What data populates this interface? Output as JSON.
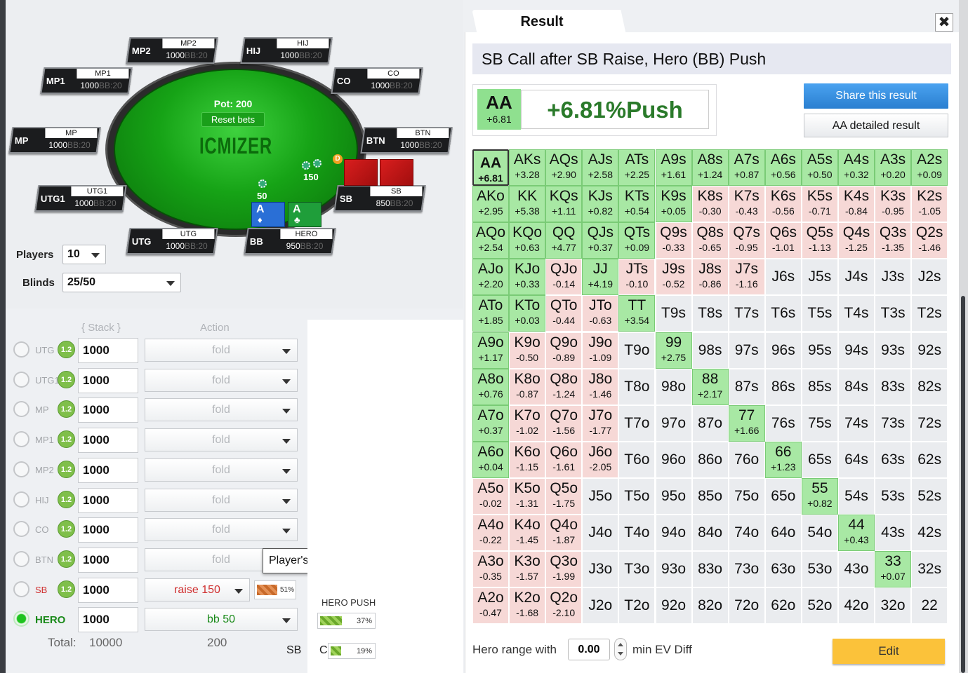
{
  "table": {
    "watermark": "ICMIZER",
    "pot_label": "Pot: 200",
    "reset_label": "Reset bets",
    "seats": [
      {
        "pos": "MP2",
        "name": "MP2",
        "stack": "1000",
        "suffix": "BB:20"
      },
      {
        "pos": "HIJ",
        "name": "HIJ",
        "stack": "1000",
        "suffix": "BB:20"
      },
      {
        "pos": "MP1",
        "name": "MP1",
        "stack": "1000",
        "suffix": "BB:20"
      },
      {
        "pos": "CO",
        "name": "CO",
        "stack": "1000",
        "suffix": "BB:20"
      },
      {
        "pos": "MP",
        "name": "MP",
        "stack": "1000",
        "suffix": "BB:20"
      },
      {
        "pos": "BTN",
        "name": "BTN",
        "stack": "1000",
        "suffix": "BB:20"
      },
      {
        "pos": "UTG1",
        "name": "UTG1",
        "stack": "1000",
        "suffix": "BB:20"
      },
      {
        "pos": "SB",
        "name": "SB",
        "stack": "850",
        "suffix": "BB:20"
      },
      {
        "pos": "UTG",
        "name": "UTG",
        "stack": "1000",
        "suffix": "BB:20"
      },
      {
        "pos": "BB",
        "name": "HERO",
        "stack": "950",
        "suffix": "BB:20"
      }
    ],
    "sb_bet": "150",
    "bb_bet": "50",
    "dealer": "D",
    "hero_cards": [
      {
        "rank": "A",
        "suit": "♦"
      },
      {
        "rank": "A",
        "suit": "♣"
      }
    ]
  },
  "settings": {
    "players_label": "Players",
    "players_value": "10",
    "blinds_label": "Blinds",
    "blinds_value": "25/50"
  },
  "actions": {
    "stack_header": "Stack",
    "action_header": "Action",
    "rows": [
      {
        "pos": "UTG",
        "badge": "1.2",
        "stack": "1000",
        "action": "fold"
      },
      {
        "pos": "UTG1",
        "badge": "1.2",
        "stack": "1000",
        "action": "fold"
      },
      {
        "pos": "MP",
        "badge": "1.2",
        "stack": "1000",
        "action": "fold"
      },
      {
        "pos": "MP1",
        "badge": "1.2",
        "stack": "1000",
        "action": "fold"
      },
      {
        "pos": "MP2",
        "badge": "1.2",
        "stack": "1000",
        "action": "fold"
      },
      {
        "pos": "HIJ",
        "badge": "1.2",
        "stack": "1000",
        "action": "fold"
      },
      {
        "pos": "CO",
        "badge": "1.2",
        "stack": "1000",
        "action": "fold"
      },
      {
        "pos": "BTN",
        "badge": "1.2",
        "stack": "1000",
        "action": "fold"
      },
      {
        "pos": "SB",
        "badge": "1.2",
        "stack": "1000",
        "action": "raise 150"
      },
      {
        "pos": "HERO",
        "badge": "",
        "stack": "1000",
        "action": "bb 50"
      }
    ],
    "sb_pct": "51%",
    "sb_pct_value": 0.51,
    "tooltip": "Player's Action Editor",
    "total_label": "Total:",
    "total_stack": "10000",
    "total_action": "200"
  },
  "hero_push": {
    "label": "HERO PUSH",
    "push_pct": "37%",
    "push_value": 0.37,
    "sb_label": "SB",
    "c_label": "C",
    "call_pct": "19%",
    "call_value": 0.19
  },
  "result": {
    "tab_title": "Result",
    "close": "✖",
    "scenario": "SB Call after SB Raise, Hero (BB) Push",
    "selected_hand": "AA",
    "selected_ev": "+6.81",
    "headline": "+6.81%Push",
    "share_label": "Share this result",
    "detail_label": "AA detailed result",
    "grid": [
      [
        [
          "AA",
          "+6.81",
          "p"
        ],
        [
          "AKs",
          "+3.28",
          "p"
        ],
        [
          "AQs",
          "+2.90",
          "p"
        ],
        [
          "AJs",
          "+2.58",
          "p"
        ],
        [
          "ATs",
          "+2.25",
          "p"
        ],
        [
          "A9s",
          "+1.61",
          "p"
        ],
        [
          "A8s",
          "+1.24",
          "p"
        ],
        [
          "A7s",
          "+0.87",
          "p"
        ],
        [
          "A6s",
          "+0.56",
          "p"
        ],
        [
          "A5s",
          "+0.50",
          "p"
        ],
        [
          "A4s",
          "+0.32",
          "p"
        ],
        [
          "A3s",
          "+0.20",
          "p"
        ],
        [
          "A2s",
          "+0.09",
          "p"
        ]
      ],
      [
        [
          "AKo",
          "+2.95",
          "p"
        ],
        [
          "KK",
          "+5.38",
          "p"
        ],
        [
          "KQs",
          "+1.11",
          "p"
        ],
        [
          "KJs",
          "+0.82",
          "p"
        ],
        [
          "KTs",
          "+0.54",
          "p"
        ],
        [
          "K9s",
          "+0.05",
          "p"
        ],
        [
          "K8s",
          "-0.30",
          "n"
        ],
        [
          "K7s",
          "-0.43",
          "n"
        ],
        [
          "K6s",
          "-0.56",
          "n"
        ],
        [
          "K5s",
          "-0.71",
          "n"
        ],
        [
          "K4s",
          "-0.84",
          "n"
        ],
        [
          "K3s",
          "-0.95",
          "n"
        ],
        [
          "K2s",
          "-1.05",
          "n"
        ]
      ],
      [
        [
          "AQo",
          "+2.54",
          "p"
        ],
        [
          "KQo",
          "+0.63",
          "p"
        ],
        [
          "QQ",
          "+4.77",
          "p"
        ],
        [
          "QJs",
          "+0.37",
          "p"
        ],
        [
          "QTs",
          "+0.09",
          "p"
        ],
        [
          "Q9s",
          "-0.33",
          "n"
        ],
        [
          "Q8s",
          "-0.65",
          "n"
        ],
        [
          "Q7s",
          "-0.95",
          "n"
        ],
        [
          "Q6s",
          "-1.01",
          "n"
        ],
        [
          "Q5s",
          "-1.13",
          "n"
        ],
        [
          "Q4s",
          "-1.25",
          "n"
        ],
        [
          "Q3s",
          "-1.35",
          "n"
        ],
        [
          "Q2s",
          "-1.46",
          "n"
        ]
      ],
      [
        [
          "AJo",
          "+2.20",
          "p"
        ],
        [
          "KJo",
          "+0.33",
          "p"
        ],
        [
          "QJo",
          "-0.14",
          "n"
        ],
        [
          "JJ",
          "+4.19",
          "p"
        ],
        [
          "JTs",
          "-0.10",
          "n"
        ],
        [
          "J9s",
          "-0.52",
          "n"
        ],
        [
          "J8s",
          "-0.86",
          "n"
        ],
        [
          "J7s",
          "-1.16",
          "n"
        ],
        [
          "J6s",
          "",
          ""
        ],
        [
          "J5s",
          "",
          ""
        ],
        [
          "J4s",
          "",
          ""
        ],
        [
          "J3s",
          "",
          ""
        ],
        [
          "J2s",
          "",
          ""
        ]
      ],
      [
        [
          "ATo",
          "+1.85",
          "p"
        ],
        [
          "KTo",
          "+0.03",
          "p"
        ],
        [
          "QTo",
          "-0.44",
          "n"
        ],
        [
          "JTo",
          "-0.63",
          "n"
        ],
        [
          "TT",
          "+3.54",
          "p"
        ],
        [
          "T9s",
          "",
          ""
        ],
        [
          "T8s",
          "",
          ""
        ],
        [
          "T7s",
          "",
          ""
        ],
        [
          "T6s",
          "",
          ""
        ],
        [
          "T5s",
          "",
          ""
        ],
        [
          "T4s",
          "",
          ""
        ],
        [
          "T3s",
          "",
          ""
        ],
        [
          "T2s",
          "",
          ""
        ]
      ],
      [
        [
          "A9o",
          "+1.17",
          "p"
        ],
        [
          "K9o",
          "-0.50",
          "n"
        ],
        [
          "Q9o",
          "-0.89",
          "n"
        ],
        [
          "J9o",
          "-1.09",
          "n"
        ],
        [
          "T9o",
          "",
          ""
        ],
        [
          "99",
          "+2.75",
          "p"
        ],
        [
          "98s",
          "",
          ""
        ],
        [
          "97s",
          "",
          ""
        ],
        [
          "96s",
          "",
          ""
        ],
        [
          "95s",
          "",
          ""
        ],
        [
          "94s",
          "",
          ""
        ],
        [
          "93s",
          "",
          ""
        ],
        [
          "92s",
          "",
          ""
        ]
      ],
      [
        [
          "A8o",
          "+0.76",
          "p"
        ],
        [
          "K8o",
          "-0.87",
          "n"
        ],
        [
          "Q8o",
          "-1.24",
          "n"
        ],
        [
          "J8o",
          "-1.46",
          "n"
        ],
        [
          "T8o",
          "",
          ""
        ],
        [
          "98o",
          "",
          ""
        ],
        [
          "88",
          "+2.17",
          "p"
        ],
        [
          "87s",
          "",
          ""
        ],
        [
          "86s",
          "",
          ""
        ],
        [
          "85s",
          "",
          ""
        ],
        [
          "84s",
          "",
          ""
        ],
        [
          "83s",
          "",
          ""
        ],
        [
          "82s",
          "",
          ""
        ]
      ],
      [
        [
          "A7o",
          "+0.37",
          "p"
        ],
        [
          "K7o",
          "-1.02",
          "n"
        ],
        [
          "Q7o",
          "-1.56",
          "n"
        ],
        [
          "J7o",
          "-1.77",
          "n"
        ],
        [
          "T7o",
          "",
          ""
        ],
        [
          "97o",
          "",
          ""
        ],
        [
          "87o",
          "",
          ""
        ],
        [
          "77",
          "+1.66",
          "p"
        ],
        [
          "76s",
          "",
          ""
        ],
        [
          "75s",
          "",
          ""
        ],
        [
          "74s",
          "",
          ""
        ],
        [
          "73s",
          "",
          ""
        ],
        [
          "72s",
          "",
          ""
        ]
      ],
      [
        [
          "A6o",
          "+0.04",
          "p"
        ],
        [
          "K6o",
          "-1.15",
          "n"
        ],
        [
          "Q6o",
          "-1.61",
          "n"
        ],
        [
          "J6o",
          "-2.05",
          "n"
        ],
        [
          "T6o",
          "",
          ""
        ],
        [
          "96o",
          "",
          ""
        ],
        [
          "86o",
          "",
          ""
        ],
        [
          "76o",
          "",
          ""
        ],
        [
          "66",
          "+1.23",
          "p"
        ],
        [
          "65s",
          "",
          ""
        ],
        [
          "64s",
          "",
          ""
        ],
        [
          "63s",
          "",
          ""
        ],
        [
          "62s",
          "",
          ""
        ]
      ],
      [
        [
          "A5o",
          "-0.02",
          "n"
        ],
        [
          "K5o",
          "-1.31",
          "n"
        ],
        [
          "Q5o",
          "-1.75",
          "n"
        ],
        [
          "J5o",
          "",
          ""
        ],
        [
          "T5o",
          "",
          ""
        ],
        [
          "95o",
          "",
          ""
        ],
        [
          "85o",
          "",
          ""
        ],
        [
          "75o",
          "",
          ""
        ],
        [
          "65o",
          "",
          ""
        ],
        [
          "55",
          "+0.82",
          "p"
        ],
        [
          "54s",
          "",
          ""
        ],
        [
          "53s",
          "",
          ""
        ],
        [
          "52s",
          "",
          ""
        ]
      ],
      [
        [
          "A4o",
          "-0.22",
          "n"
        ],
        [
          "K4o",
          "-1.45",
          "n"
        ],
        [
          "Q4o",
          "-1.87",
          "n"
        ],
        [
          "J4o",
          "",
          ""
        ],
        [
          "T4o",
          "",
          ""
        ],
        [
          "94o",
          "",
          ""
        ],
        [
          "84o",
          "",
          ""
        ],
        [
          "74o",
          "",
          ""
        ],
        [
          "64o",
          "",
          ""
        ],
        [
          "54o",
          "",
          ""
        ],
        [
          "44",
          "+0.43",
          "p"
        ],
        [
          "43s",
          "",
          ""
        ],
        [
          "42s",
          "",
          ""
        ]
      ],
      [
        [
          "A3o",
          "-0.35",
          "n"
        ],
        [
          "K3o",
          "-1.57",
          "n"
        ],
        [
          "Q3o",
          "-1.99",
          "n"
        ],
        [
          "J3o",
          "",
          ""
        ],
        [
          "T3o",
          "",
          ""
        ],
        [
          "93o",
          "",
          ""
        ],
        [
          "83o",
          "",
          ""
        ],
        [
          "73o",
          "",
          ""
        ],
        [
          "63o",
          "",
          ""
        ],
        [
          "53o",
          "",
          ""
        ],
        [
          "43o",
          "",
          ""
        ],
        [
          "33",
          "+0.07",
          "p"
        ],
        [
          "32s",
          "",
          ""
        ]
      ],
      [
        [
          "A2o",
          "-0.47",
          "n"
        ],
        [
          "K2o",
          "-1.68",
          "n"
        ],
        [
          "Q2o",
          "-2.10",
          "n"
        ],
        [
          "J2o",
          "",
          ""
        ],
        [
          "T2o",
          "",
          ""
        ],
        [
          "92o",
          "",
          ""
        ],
        [
          "82o",
          "",
          ""
        ],
        [
          "72o",
          "",
          ""
        ],
        [
          "62o",
          "",
          ""
        ],
        [
          "52o",
          "",
          ""
        ],
        [
          "42o",
          "",
          ""
        ],
        [
          "32o",
          "",
          ""
        ],
        [
          "22",
          "",
          ""
        ]
      ]
    ],
    "hero_range_label": "Hero range with",
    "ev_value": "0.00",
    "ev_suffix": "min EV Diff",
    "edit_label": "Edit"
  }
}
